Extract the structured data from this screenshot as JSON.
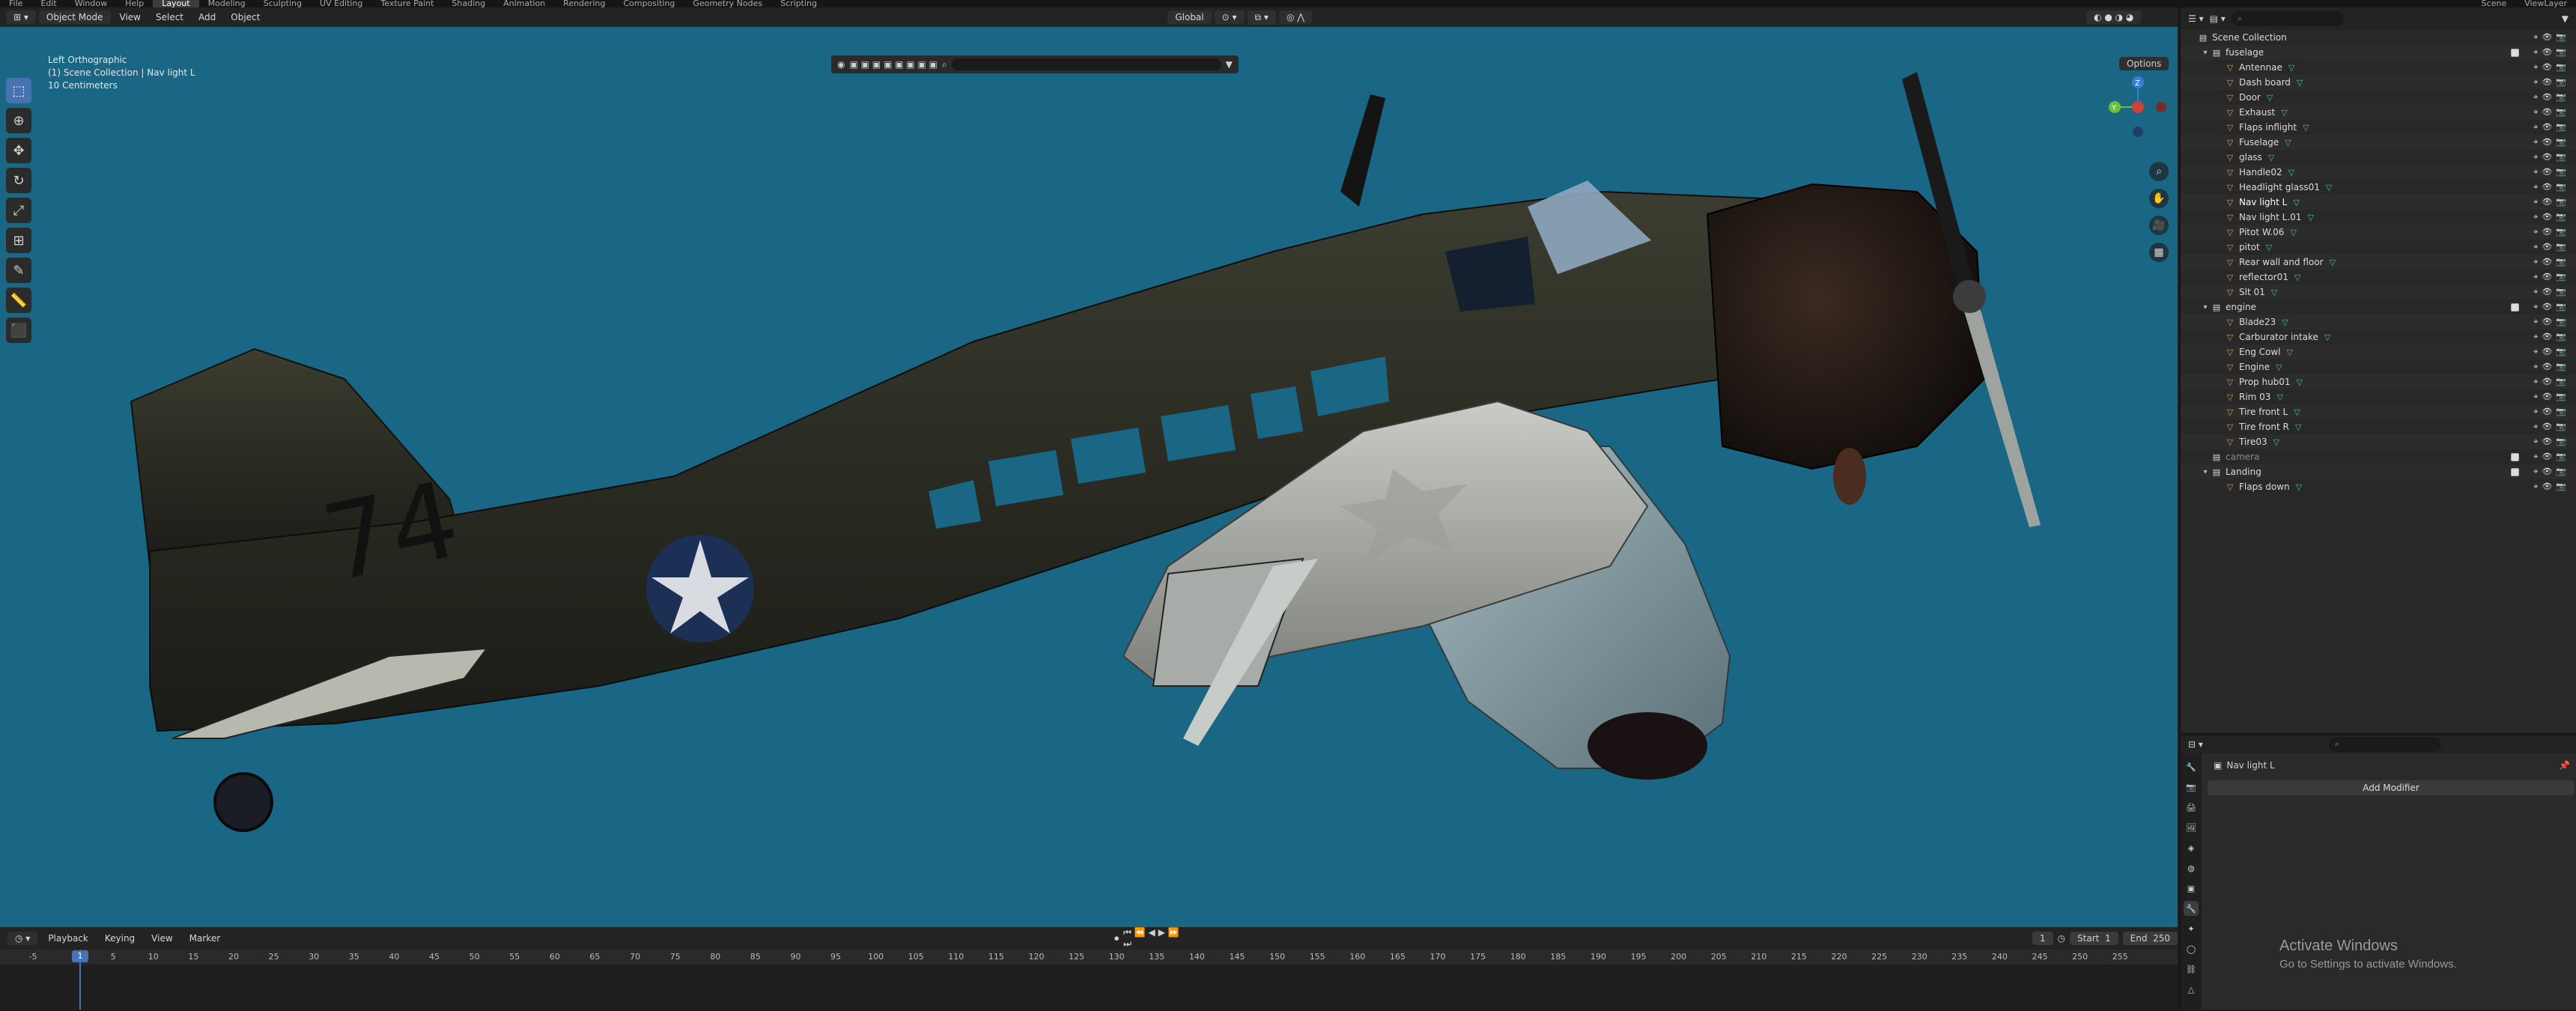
{
  "topbar": {
    "menus": [
      "File",
      "Edit",
      "Window",
      "Help"
    ],
    "workspaces": [
      "Layout",
      "Modeling",
      "Sculpting",
      "UV Editing",
      "Texture Paint",
      "Shading",
      "Animation",
      "Rendering",
      "Compositing",
      "Geometry Nodes",
      "Scripting"
    ],
    "active_workspace": "Layout",
    "scene": "Scene",
    "view_layer": "ViewLayer"
  },
  "viewport": {
    "mode": "Object Mode",
    "menus": [
      "View",
      "Select",
      "Add",
      "Object"
    ],
    "transform_orientation": "Global",
    "options": "Options",
    "overlay_lines": [
      "Left Orthographic",
      "(1) Scene Collection | Nav light L",
      "10 Centimeters"
    ],
    "bg_color": "#1a6685",
    "tools": [
      "select-icon",
      "cursor-icon",
      "move-icon",
      "rotate-icon",
      "scale-icon",
      "transform-icon",
      "annotate-icon",
      "measure-icon",
      "add-cube-icon"
    ],
    "nav": [
      "zoom-icon",
      "pan-icon",
      "camera-icon",
      "grid-icon"
    ],
    "plane_number": "74"
  },
  "outliner": {
    "search_placeholder": "",
    "root": "Scene Collection",
    "collections": [
      {
        "name": "fuselage",
        "items": [
          "Antennae",
          "Dash board",
          "Door",
          "Exhaust",
          "Flaps inflight",
          "Fuselage",
          "glass",
          "Handle02",
          "Headlight glass01",
          "Nav light L",
          "Nav light L.01",
          "Pitot W.06",
          "pitot",
          "Rear wall and floor",
          "reflector01",
          "Slt 01"
        ]
      },
      {
        "name": "engine",
        "items": [
          "Blade23",
          "Carburator intake",
          "Eng Cowl",
          "Engine",
          "Prop hub01",
          "Rim 03",
          "Tire front L",
          "Tire front R",
          "Tire03"
        ]
      },
      {
        "name": "camera",
        "items": []
      },
      {
        "name": "Landing",
        "items": [
          "Flaps down"
        ]
      }
    ],
    "selected": "Nav light L"
  },
  "properties": {
    "object_name": "Nav light L",
    "add_modifier": "Add Modifier"
  },
  "timeline": {
    "menus": [
      "Playback",
      "Keying",
      "View",
      "Marker"
    ],
    "current_frame": "1",
    "start_label": "Start",
    "start": "1",
    "end_label": "End",
    "end": "250",
    "ticks": [
      "-5",
      "1",
      "5",
      "10",
      "15",
      "20",
      "25",
      "30",
      "35",
      "40",
      "45",
      "50",
      "55",
      "60",
      "65",
      "70",
      "75",
      "80",
      "85",
      "90",
      "95",
      "100",
      "105",
      "110",
      "115",
      "120",
      "125",
      "130",
      "135",
      "140",
      "145",
      "150",
      "155",
      "160",
      "165",
      "170",
      "175",
      "180",
      "185",
      "190",
      "195",
      "200",
      "205",
      "210",
      "215",
      "220",
      "225",
      "230",
      "235",
      "240",
      "245",
      "250",
      "255"
    ]
  },
  "watermark": {
    "title": "Activate Windows",
    "subtitle": "Go to Settings to activate Windows."
  }
}
